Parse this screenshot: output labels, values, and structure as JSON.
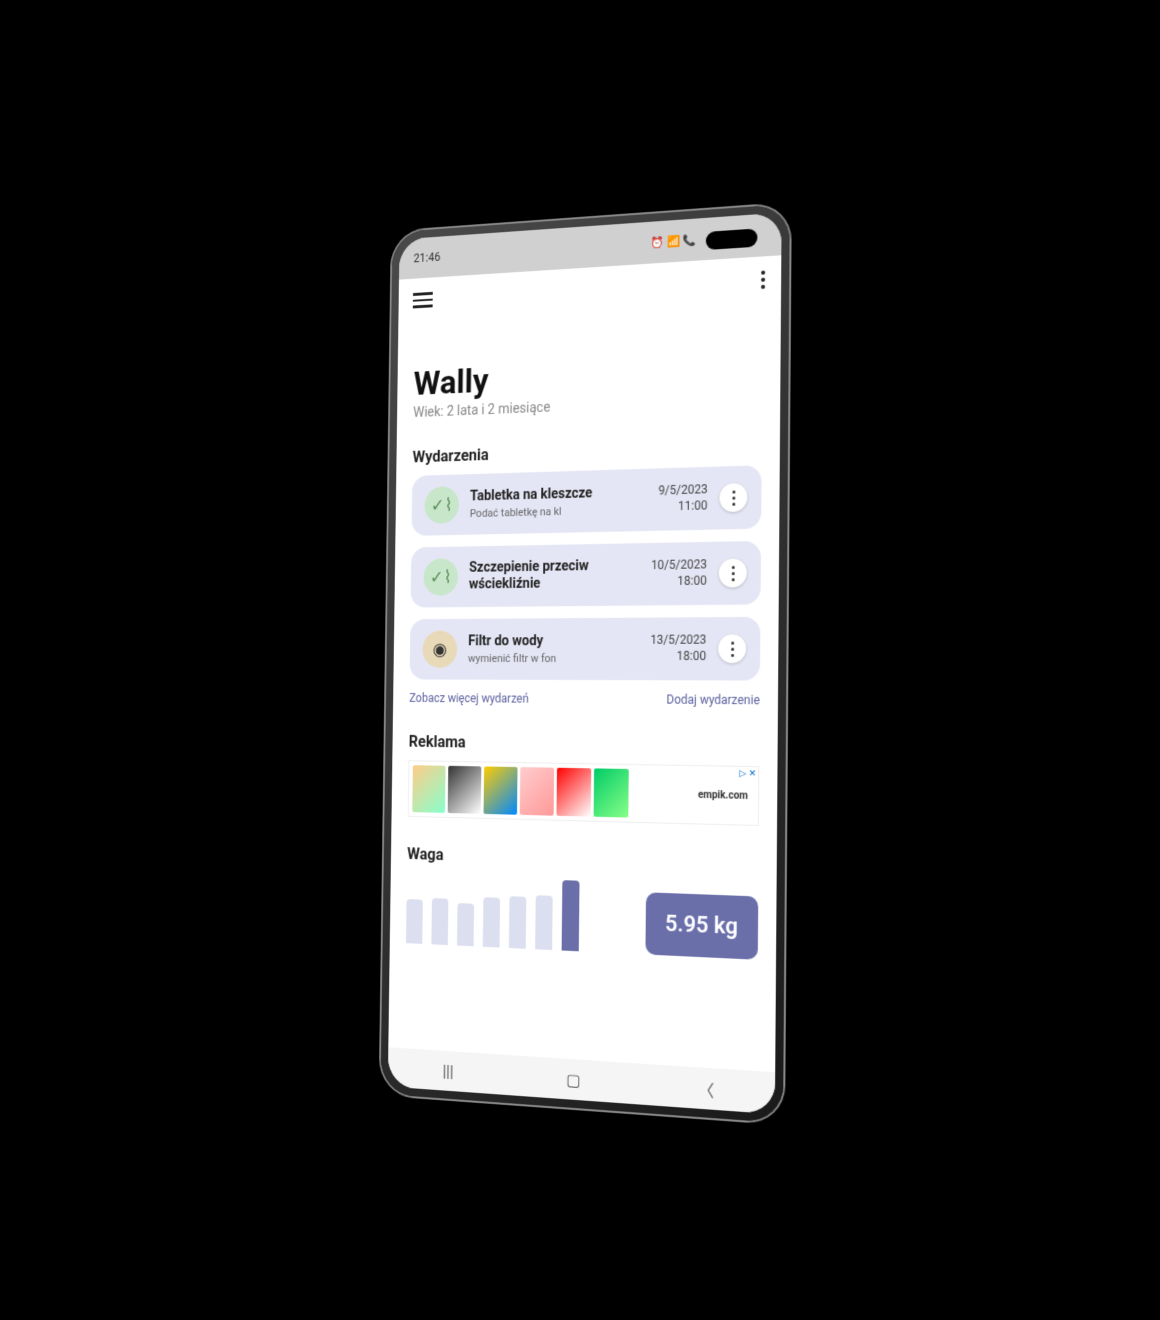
{
  "status": {
    "time": "21:46",
    "icons": "⏰ 📶 📞"
  },
  "pet": {
    "name": "Wally",
    "age": "Wiek: 2 lata i 2 miesiące"
  },
  "sections": {
    "events": "Wydarzenia",
    "ad": "Reklama",
    "weight": "Waga"
  },
  "events": [
    {
      "title": "Tabletka na kleszcze",
      "sub": "Podać tabletkę na kl",
      "date": "9/5/2023",
      "time": "11:00",
      "iconType": "medical"
    },
    {
      "title": "Szczepienie przeciw wściekliźnie",
      "sub": "",
      "date": "10/5/2023",
      "time": "18:00",
      "iconType": "medical"
    },
    {
      "title": "Filtr do wody",
      "sub": "wymienić filtr w fon",
      "date": "13/5/2023",
      "time": "18:00",
      "iconType": "filter"
    }
  ],
  "eventActions": {
    "more": "Zobacz więcej wydarzeń",
    "add": "Dodaj wydarzenie"
  },
  "ad": {
    "brand": "empik.com",
    "marker": "▷ ✕"
  },
  "weight": {
    "current": "5.95 kg"
  },
  "chart_data": {
    "type": "bar",
    "categories": [
      "",
      "",
      "",
      "",
      "",
      "",
      ""
    ],
    "values": [
      40,
      42,
      38,
      44,
      46,
      48,
      62
    ],
    "title": "Waga",
    "ylabel": "",
    "note": "relative heights of weight history bars; last bar highlighted, current value 5.95 kg"
  }
}
